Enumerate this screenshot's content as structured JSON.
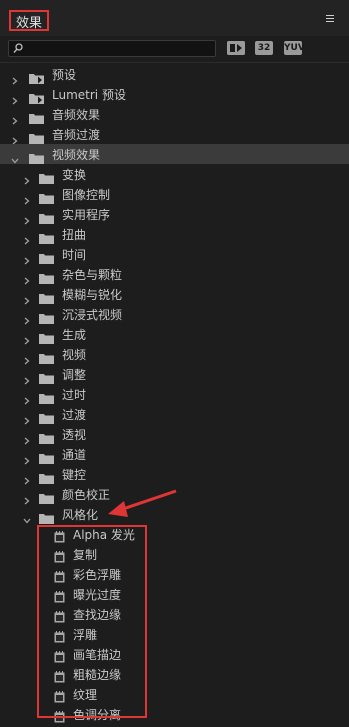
{
  "panel": {
    "title": "效果"
  },
  "search": {
    "placeholder": ""
  },
  "toolbar": {
    "accelerated_label": "",
    "bit32_label": "32",
    "yuv_label": "YUV"
  },
  "tree": {
    "top": [
      {
        "label": "预设",
        "icon": "preset-folder-icon",
        "expanded": false
      },
      {
        "label": "Lumetri 预设",
        "icon": "preset-folder-icon",
        "expanded": false
      },
      {
        "label": "音频效果",
        "icon": "folder-icon",
        "expanded": false
      },
      {
        "label": "音频过渡",
        "icon": "folder-icon",
        "expanded": false
      },
      {
        "label": "视频效果",
        "icon": "folder-icon",
        "expanded": true
      }
    ],
    "video_effects": [
      {
        "label": "变换"
      },
      {
        "label": "图像控制"
      },
      {
        "label": "实用程序"
      },
      {
        "label": "扭曲"
      },
      {
        "label": "时间"
      },
      {
        "label": "杂色与颗粒"
      },
      {
        "label": "模糊与锐化"
      },
      {
        "label": "沉浸式视频"
      },
      {
        "label": "生成"
      },
      {
        "label": "视频"
      },
      {
        "label": "调整"
      },
      {
        "label": "过时"
      },
      {
        "label": "过渡"
      },
      {
        "label": "透视"
      },
      {
        "label": "通道"
      },
      {
        "label": "键控"
      },
      {
        "label": "颜色校正"
      },
      {
        "label": "风格化",
        "expanded": true
      }
    ],
    "stylize_effects": [
      {
        "label": "Alpha 发光"
      },
      {
        "label": "复制"
      },
      {
        "label": "彩色浮雕"
      },
      {
        "label": "曝光过度"
      },
      {
        "label": "查找边缘"
      },
      {
        "label": "浮雕"
      },
      {
        "label": "画笔描边"
      },
      {
        "label": "粗糙边缘"
      },
      {
        "label": "纹理"
      },
      {
        "label": "色调分离"
      }
    ]
  },
  "colors": {
    "highlight": "#e03535",
    "selected_row": "#3b3b3b",
    "background": "#1d1d1d"
  }
}
